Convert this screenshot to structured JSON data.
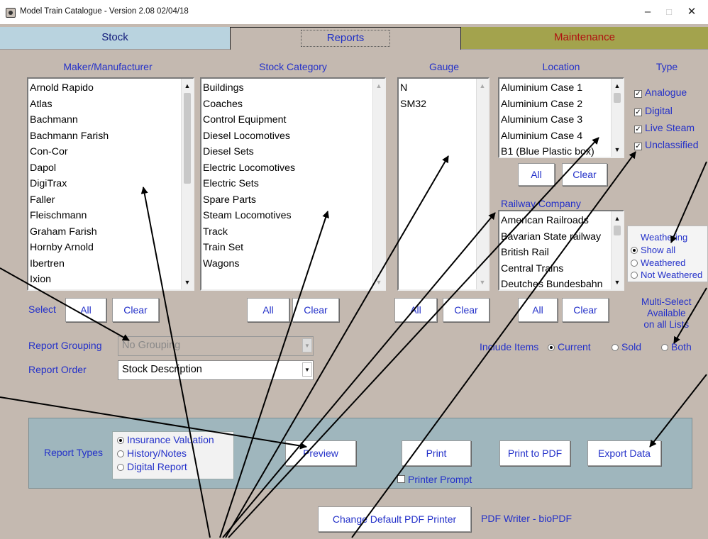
{
  "window": {
    "title": "Model Train Catalogue - Version 2.08 02/04/18",
    "minimize": "–",
    "maximize": "□",
    "close": "✕"
  },
  "tabs": [
    {
      "label": "Stock"
    },
    {
      "label": "Reports"
    },
    {
      "label": "Maintenance"
    }
  ],
  "maker": {
    "header": "Maker/Manufacturer",
    "items": [
      "Arnold Rapido",
      "Atlas",
      "Bachmann",
      "Bachmann Farish",
      "Con-Cor",
      "Dapol",
      "DigiTrax",
      "Faller",
      "Fleischmann",
      "Graham Farish",
      "Hornby Arnold",
      "Ibertren",
      "Ixion"
    ]
  },
  "category": {
    "header": "Stock Category",
    "items": [
      "Buildings",
      "Coaches",
      "Control Equipment",
      "Diesel Locomotives",
      "Diesel Sets",
      "Electric Locomotives",
      "Electric Sets",
      "Spare Parts",
      "Steam Locomotives",
      "Track",
      "Train Set",
      "Wagons"
    ]
  },
  "gauge": {
    "header": "Gauge",
    "items": [
      "N",
      "SM32"
    ]
  },
  "location": {
    "header": "Location",
    "items": [
      "Aluminium Case 1",
      "Aluminium Case 2",
      "Aluminium Case 3",
      "Aluminium Case 4",
      "B1 (Blue Plastic box)"
    ]
  },
  "railway": {
    "header": "Railway Company",
    "items": [
      "American Railroads",
      "Bavarian State railway",
      "British Rail",
      "Central Trains",
      "Deutches Bundesbahn"
    ]
  },
  "type": {
    "header": "Type",
    "options": [
      {
        "label": "Analogue",
        "checked": true
      },
      {
        "label": "Digital",
        "checked": true
      },
      {
        "label": "Live Steam",
        "checked": true
      },
      {
        "label": "Unclassified",
        "checked": true
      }
    ]
  },
  "weathering": {
    "title": "Weathering",
    "options": [
      {
        "label": "Show all",
        "selected": true
      },
      {
        "label": "Weathered",
        "selected": false
      },
      {
        "label": "Not Weathered",
        "selected": false
      }
    ]
  },
  "buttons": {
    "all": "All",
    "clear": "Clear",
    "select": "Select"
  },
  "multi_select_note": [
    "Multi-Select",
    "Available",
    "on all Lists"
  ],
  "include_items": {
    "label": "Include Items",
    "options": [
      {
        "label": "Current",
        "selected": true
      },
      {
        "label": "Sold",
        "selected": false
      },
      {
        "label": "Both",
        "selected": false
      }
    ]
  },
  "report_grouping": {
    "label": "Report Grouping",
    "value": "No Grouping"
  },
  "report_order": {
    "label": "Report Order",
    "value": "Stock Description"
  },
  "report_types": {
    "label": "Report Types",
    "options": [
      {
        "label": "Insurance Valuation",
        "selected": true
      },
      {
        "label": "History/Notes",
        "selected": false
      },
      {
        "label": "Digital Report",
        "selected": false
      }
    ]
  },
  "actions": {
    "preview": "Preview",
    "print": "Print",
    "print_pdf": "Print to PDF",
    "export": "Export Data",
    "printer_prompt": "Printer Prompt",
    "change_pdf": "Change Default PDF Printer",
    "pdf_writer": "PDF Writer - bioPDF"
  }
}
